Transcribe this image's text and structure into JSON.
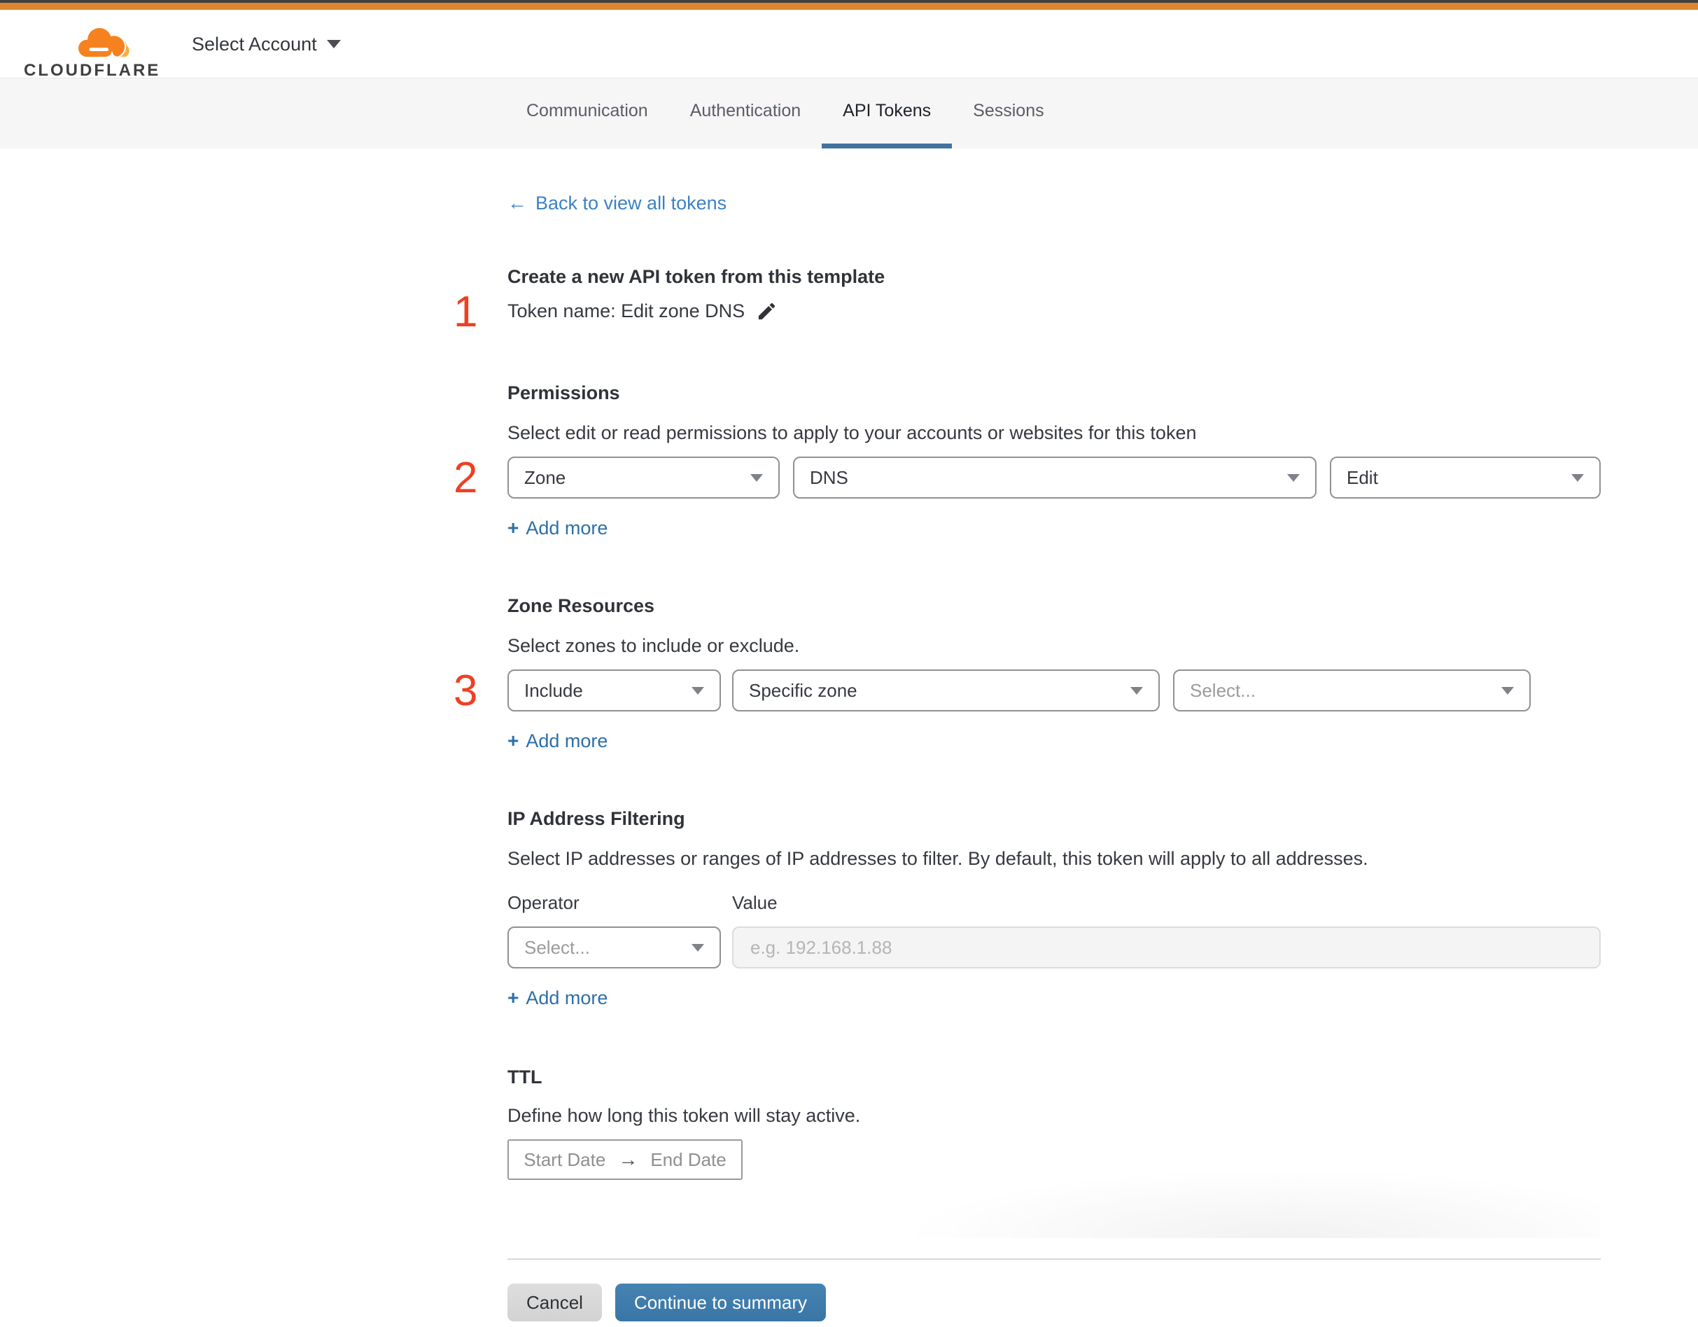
{
  "header": {
    "brand": "CLOUDFLARE",
    "account_selector": "Select Account"
  },
  "tabs": [
    {
      "label": "Communication"
    },
    {
      "label": "Authentication"
    },
    {
      "label": "API Tokens"
    },
    {
      "label": "Sessions"
    }
  ],
  "active_tab": "API Tokens",
  "back_link": {
    "arrow": "←",
    "label": "Back to view all tokens"
  },
  "token_template": {
    "step": "1",
    "heading": "Create a new API token from this template",
    "token_name": "Token name: Edit zone DNS"
  },
  "permissions": {
    "step": "2",
    "heading": "Permissions",
    "description": "Select edit or read permissions to apply to your accounts or websites for this token",
    "scope": "Zone",
    "category": "DNS",
    "access": "Edit",
    "plus": "+",
    "add_more": "Add more"
  },
  "zone_resources": {
    "step": "3",
    "heading": "Zone Resources",
    "description": "Select zones to include or exclude.",
    "mode": "Include",
    "scope": "Specific zone",
    "zone_placeholder": "Select...",
    "plus": "+",
    "add_more": "Add more"
  },
  "ip_filtering": {
    "heading": "IP Address Filtering",
    "description": "Select IP addresses or ranges of IP addresses to filter. By default, this token will apply to all addresses.",
    "operator_label": "Operator",
    "value_label": "Value",
    "operator_placeholder": "Select...",
    "value_placeholder": "e.g. 192.168.1.88",
    "plus": "+",
    "add_more": "Add more"
  },
  "ttl": {
    "heading": "TTL",
    "description": "Define how long this token will stay active.",
    "start_date": "Start Date",
    "arrow": "→",
    "end_date": "End Date"
  },
  "footer": {
    "cancel": "Cancel",
    "continue": "Continue to summary"
  },
  "colors": {
    "top_accent_orange": "#dd8630",
    "brand_orange": "#f6821f",
    "brand_orange_light": "#fbad41",
    "step_number_red": "#ee4023",
    "link_blue": "#3b82c4",
    "add_more_blue": "#2d6fa7",
    "tab_underline_blue": "#40739f",
    "primary_button_blue": "#3f7cab"
  }
}
